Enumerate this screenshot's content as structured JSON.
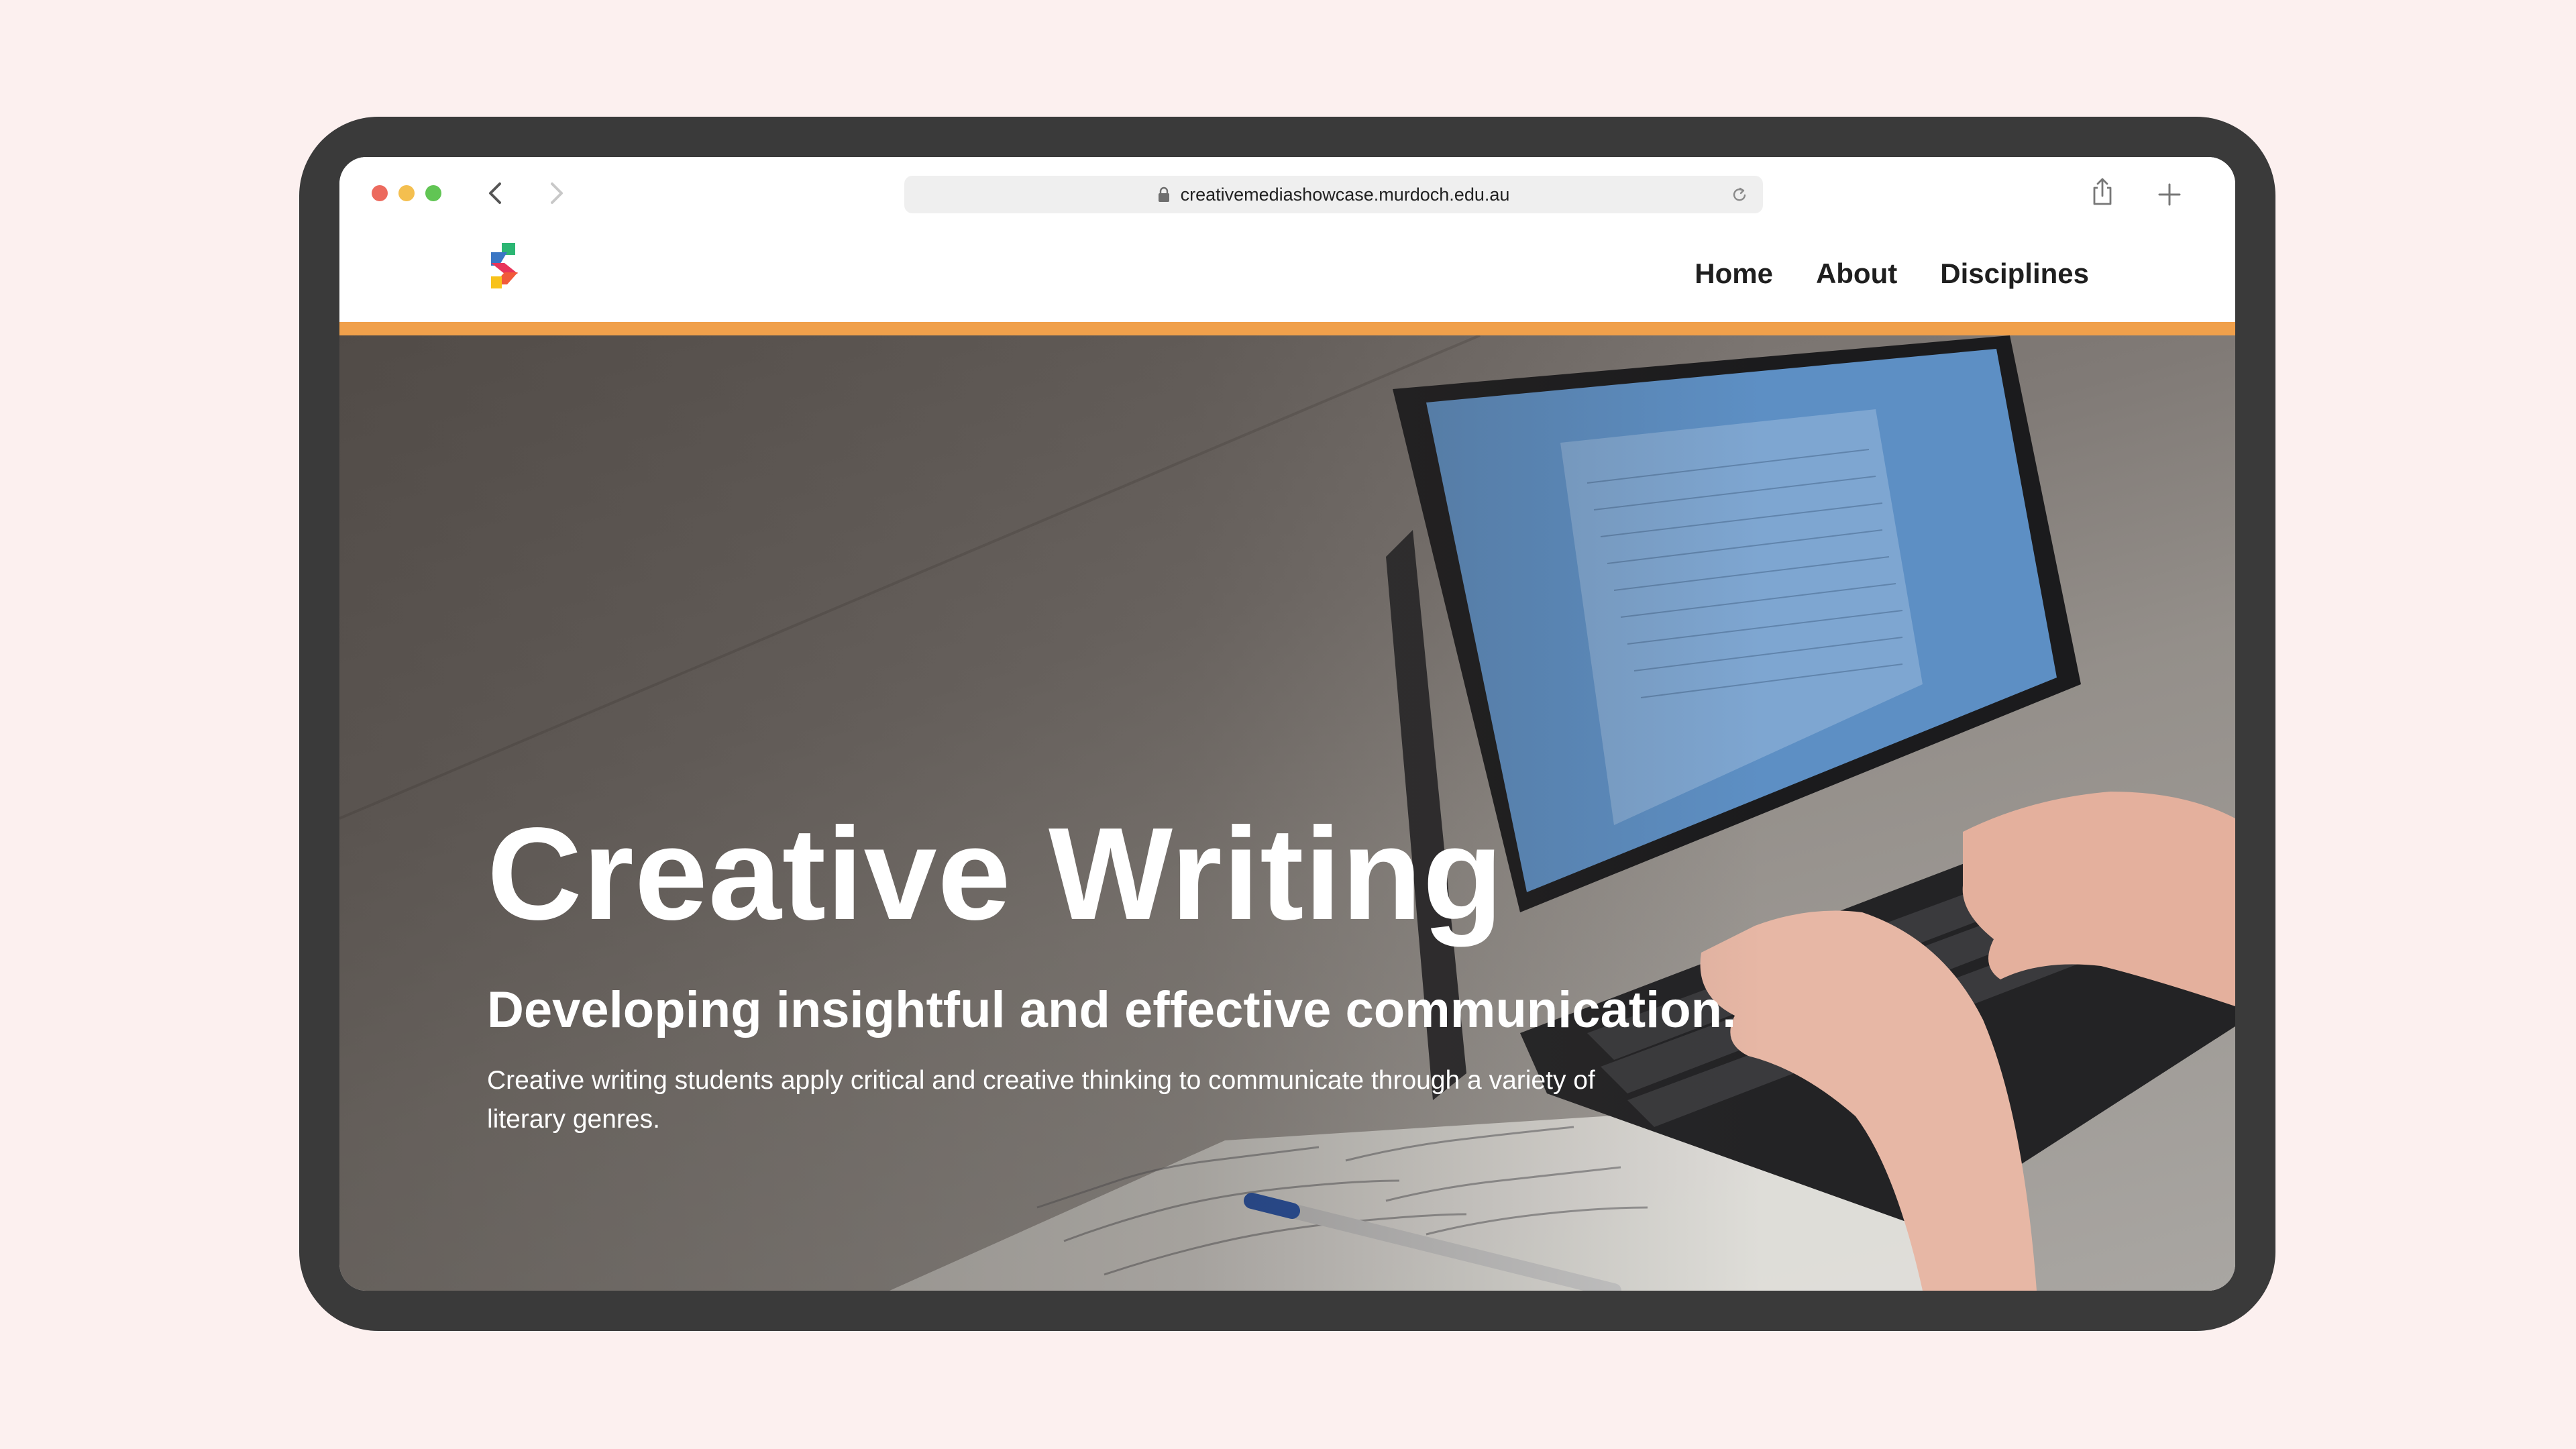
{
  "browser": {
    "url": "creativemediashowcase.murdoch.edu.au",
    "traffic_colors": [
      "#ec6a5e",
      "#f4bf4f",
      "#61c554"
    ],
    "icons": [
      "back-arrow-icon",
      "forward-arrow-icon",
      "lock-icon",
      "reload-icon",
      "share-icon",
      "new-tab-icon"
    ]
  },
  "site": {
    "logo": "showcase-s-logo",
    "nav": {
      "home": "Home",
      "about": "About",
      "disciplines": "Disciplines"
    },
    "accent_color": "#f0a04b"
  },
  "hero": {
    "title": "Creative Writing",
    "subtitle": "Developing insightful and effective communication.",
    "description": "Creative writing students apply critical and creative thinking to communicate through a variety of literary genres."
  }
}
